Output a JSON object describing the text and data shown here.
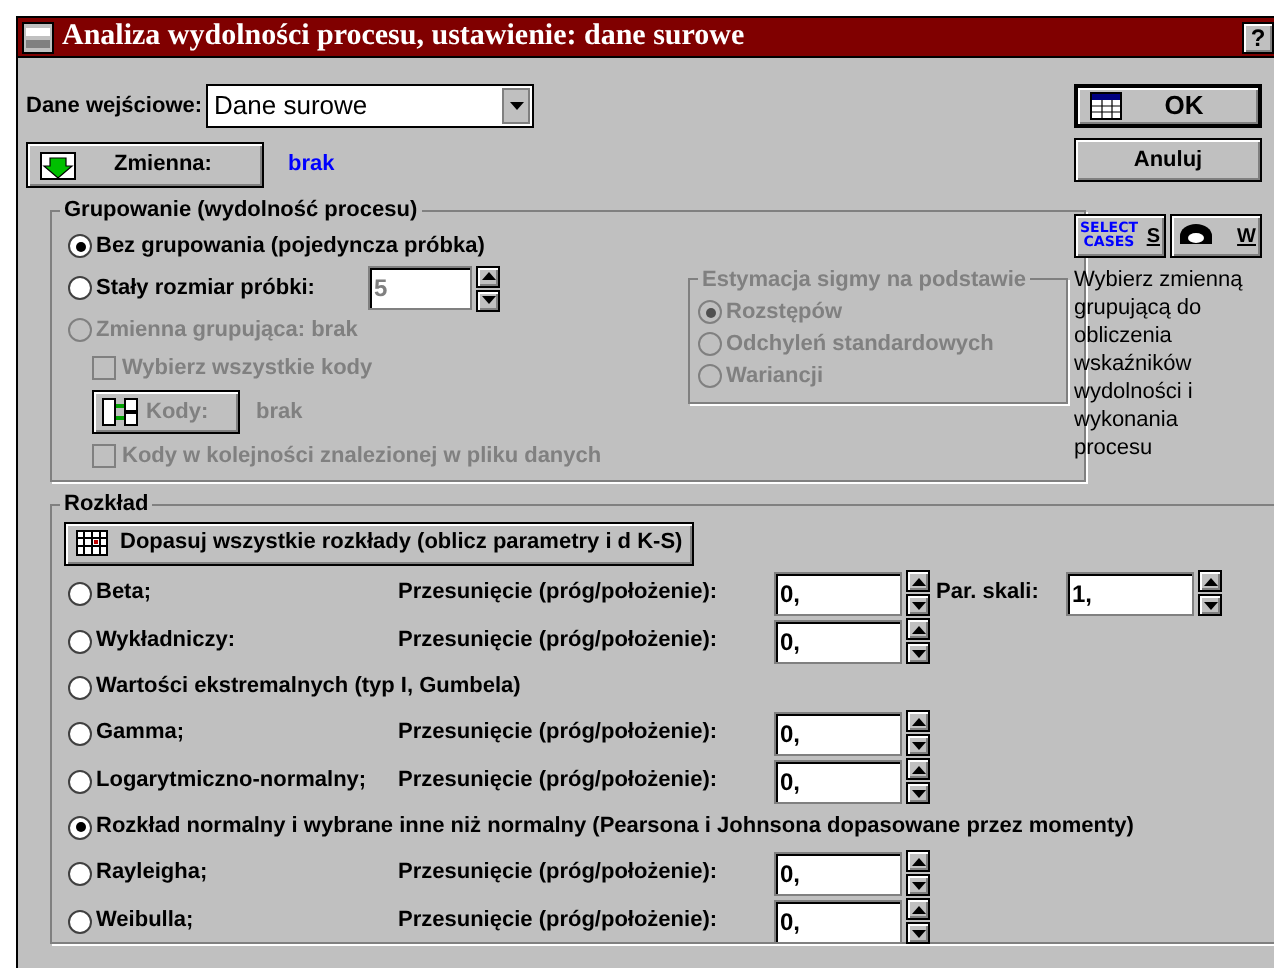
{
  "window": {
    "title": "Analiza wydolności procesu, ustawienie: dane surowe",
    "help": "?"
  },
  "input": {
    "label": "Dane wejściowe:",
    "value": "Dane surowe"
  },
  "variable": {
    "button": "Zmienna:",
    "value": "brak"
  },
  "buttons": {
    "ok": "OK",
    "cancel": "Anuluj"
  },
  "tools": [
    {
      "kind": "select",
      "icon_lines": [
        "SELECT",
        "CASES"
      ],
      "label": "S"
    },
    {
      "kind": "weight",
      "label": "W"
    }
  ],
  "hint": "Wybierz zmienną grupującą do obliczenia wskaźników wydolności i wykonania procesu",
  "grouping": {
    "title": "Grupowanie (wydolność procesu)",
    "items": [
      {
        "kind": "radio",
        "label": "Bez grupowania (pojedyncza próbka)",
        "selected": true,
        "disabled": false
      },
      {
        "kind": "radio_field",
        "label": "Stały rozmiar próbki:",
        "value": "5",
        "selected": false,
        "disabled": false,
        "field_disabled": true
      },
      {
        "kind": "radio",
        "label": "Zmienna grupująca: brak",
        "selected": false,
        "disabled": true
      },
      {
        "kind": "checkbox",
        "label": "Wybierz wszystkie kody",
        "checked": false,
        "disabled": true
      },
      {
        "kind": "codes",
        "label": "Kody:",
        "value": "brak",
        "disabled": true
      },
      {
        "kind": "checkbox",
        "label": "Kody w kolejności znalezionej w pliku danych",
        "checked": false,
        "disabled": true
      }
    ],
    "sigma": {
      "title": "Estymacja sigmy na podstawie",
      "disabled": true,
      "options": [
        {
          "label": "Rozstępów",
          "selected": true
        },
        {
          "label": "Odchyleń standardowych",
          "selected": false
        },
        {
          "label": "Wariancji",
          "selected": false
        }
      ]
    }
  },
  "distribution": {
    "title": "Rozkład",
    "fit_button": "Dopasuj wszystkie rozkłady (oblicz parametry i d K-S)",
    "items": [
      {
        "label": "Beta;",
        "selected": false,
        "shift": {
          "label": "Przesunięcie (próg/położenie):",
          "value": "0,"
        },
        "scale": {
          "label": "Par. skali:",
          "value": "1,"
        }
      },
      {
        "label": "Wykładniczy:",
        "selected": false,
        "shift": {
          "label": "Przesunięcie (próg/położenie):",
          "value": "0,"
        }
      },
      {
        "label": "Wartości ekstremalnych (typ I, Gumbela)",
        "selected": false
      },
      {
        "label": "Gamma;",
        "selected": false,
        "shift": {
          "label": "Przesunięcie (próg/położenie):",
          "value": "0,"
        }
      },
      {
        "label": "Logarytmiczno-normalny;",
        "selected": false,
        "shift": {
          "label": "Przesunięcie (próg/położenie):",
          "value": "0,"
        }
      },
      {
        "label": "Rozkład normalny i wybrane inne niż normalny (Pearsona i Johnsona dopasowane przez momenty)",
        "selected": true
      },
      {
        "label": "Rayleigha;",
        "selected": false,
        "shift": {
          "label": "Przesunięcie (próg/położenie):",
          "value": "0,"
        }
      },
      {
        "label": "Weibulla;",
        "selected": false,
        "shift": {
          "label": "Przesunięcie (próg/położenie):",
          "value": "0,"
        }
      }
    ]
  }
}
